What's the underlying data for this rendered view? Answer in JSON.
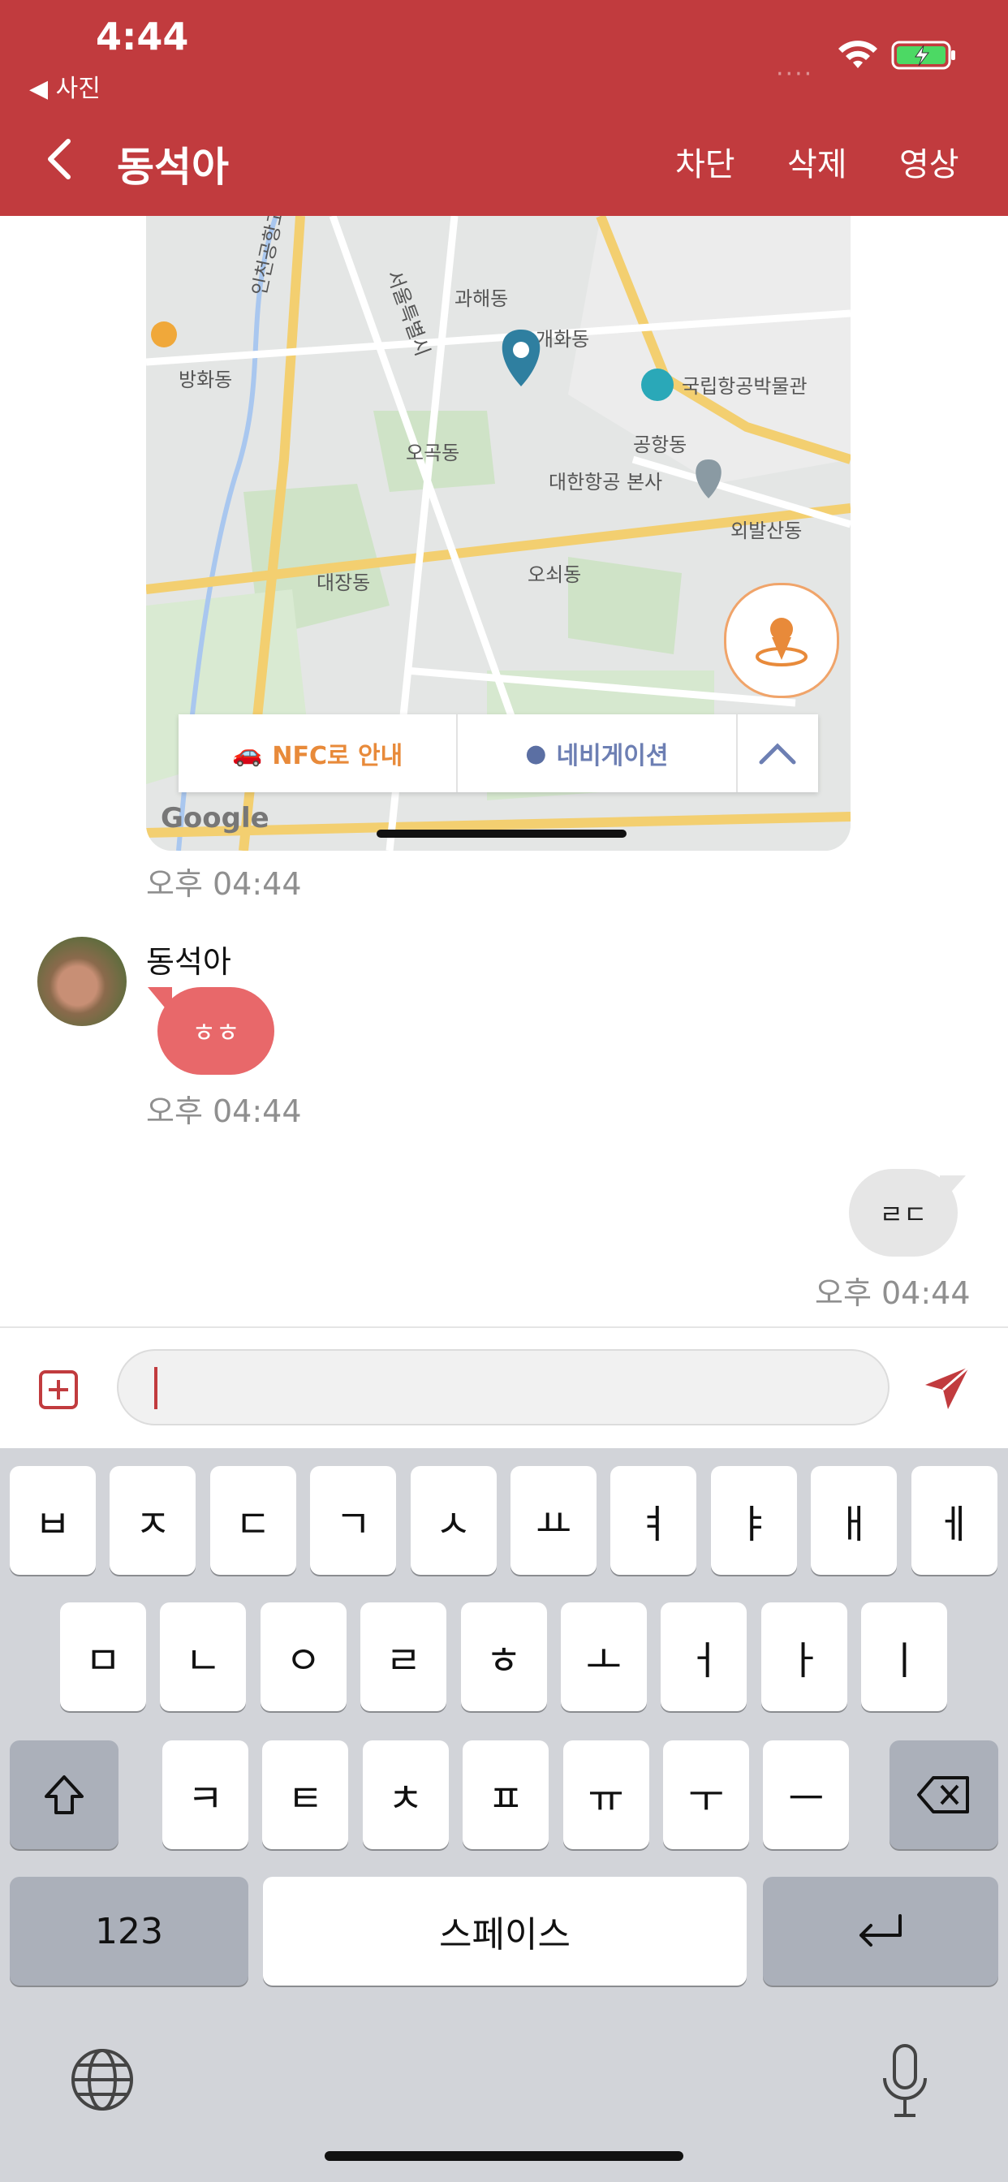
{
  "status": {
    "time": "4:44",
    "back_app": "◀ 사진",
    "signal": "····"
  },
  "header": {
    "title": "동석아",
    "block": "차단",
    "delete": "삭제",
    "video": "영상"
  },
  "map": {
    "labels": [
      "인천공항고속도로",
      "서울특별시",
      "국립항공박물관",
      "대한항공 본사",
      "공항동",
      "외발산동",
      "개화동",
      "과해동",
      "오곡동",
      "오쇠동",
      "대장동",
      "방화동"
    ],
    "nfc": "NFC로 안내",
    "navigation": "네비게이션",
    "google": "Google"
  },
  "messages": {
    "ts1": "오후 04:44",
    "sender": "동석아",
    "incoming_text": "ㅎㅎ",
    "ts2": "오후 04:44",
    "outgoing_text": "ㄹㄷ",
    "ts3": "오후 04:44"
  },
  "input": {
    "value": "",
    "placeholder": ""
  },
  "keyboard": {
    "row1": [
      "ㅂ",
      "ㅈ",
      "ㄷ",
      "ㄱ",
      "ㅅ",
      "ㅛ",
      "ㅕ",
      "ㅑ",
      "ㅐ",
      "ㅔ"
    ],
    "row2": [
      "ㅁ",
      "ㄴ",
      "ㅇ",
      "ㄹ",
      "ㅎ",
      "ㅗ",
      "ㅓ",
      "ㅏ",
      "ㅣ"
    ],
    "row3": [
      "ㅋ",
      "ㅌ",
      "ㅊ",
      "ㅍ",
      "ㅠ",
      "ㅜ",
      "ㅡ"
    ],
    "numbers": "123",
    "space": "스페이스"
  },
  "colors": {
    "brand": "#c13b3e",
    "incoming_bubble": "#e8686a",
    "outgoing_bubble": "#e6e6e6"
  }
}
